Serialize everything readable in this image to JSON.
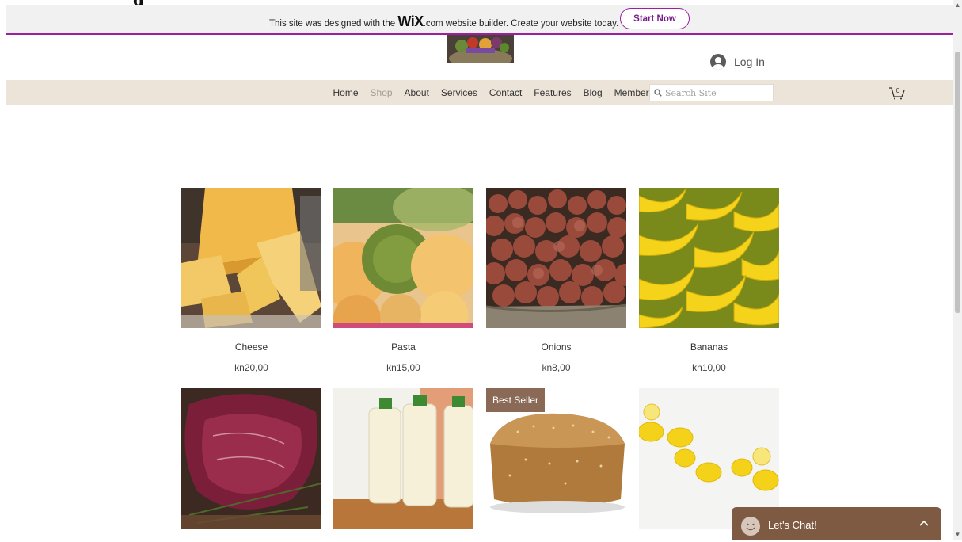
{
  "stray_text": "g",
  "wix_banner": {
    "message_before": "This site was designed with the ",
    "wix_brand": "WiX",
    "message_after": ".com website builder. Create your website today.",
    "start_button": "Start Now"
  },
  "header": {
    "login_label": "Log In"
  },
  "nav": {
    "items": [
      {
        "label": "Home"
      },
      {
        "label": "Shop",
        "active": true
      },
      {
        "label": "About"
      },
      {
        "label": "Services"
      },
      {
        "label": "Contact"
      },
      {
        "label": "Features"
      },
      {
        "label": "Blog"
      },
      {
        "label": "Members"
      }
    ],
    "search_placeholder": "Search Site",
    "cart_count": "0"
  },
  "products": [
    {
      "name": "Cheese",
      "price": "kn20,00"
    },
    {
      "name": "Pasta",
      "price": "kn15,00"
    },
    {
      "name": "Onions",
      "price": "kn8,00"
    },
    {
      "name": "Bananas",
      "price": "kn10,00"
    },
    {
      "name": "",
      "price": ""
    },
    {
      "name": "",
      "price": ""
    },
    {
      "name": "",
      "price": "",
      "ribbon": "Best Seller"
    },
    {
      "name": "",
      "price": ""
    }
  ],
  "chat": {
    "label": "Let's Chat!"
  },
  "colors": {
    "wix_accent": "#9b1f9e",
    "nav_bg": "#ece4d8",
    "chat_bg": "#7f5a43",
    "ribbon_bg": "#8a6a57"
  }
}
